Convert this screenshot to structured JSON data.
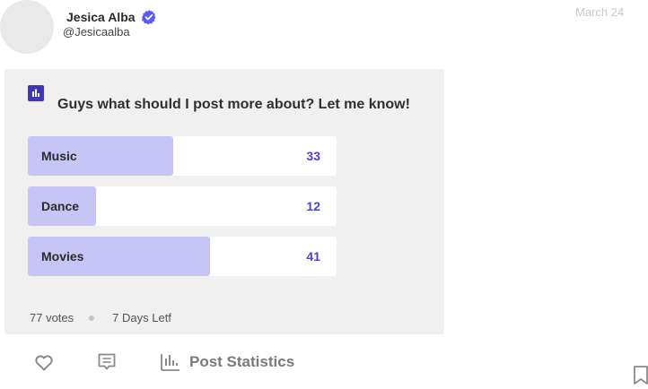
{
  "user": {
    "name": "Jesica Alba",
    "handle": "@Jesicaalba",
    "verified": true,
    "verified_color": "#5b5cf6"
  },
  "post": {
    "date": "March 24",
    "poll_icon": "bar-chart-icon",
    "question": "Guys what should I post more about? Let me know!",
    "options": [
      {
        "label": "Music",
        "votes": "33",
        "fraction": 0.47
      },
      {
        "label": "Dance",
        "votes": "12",
        "fraction": 0.22
      },
      {
        "label": "Movies",
        "votes": "41",
        "fraction": 0.59
      }
    ],
    "accent_color": "#4a45d0",
    "fill_color": "#c6c5f6",
    "total_votes": "77 votes",
    "time_left": "7 Days Letf"
  },
  "actions": {
    "like_icon": "heart-icon",
    "comment_icon": "comment-icon",
    "stats_icon": "bar-chart-icon",
    "stats_label": "Post Statistics",
    "bookmark_icon": "bookmark-icon"
  }
}
